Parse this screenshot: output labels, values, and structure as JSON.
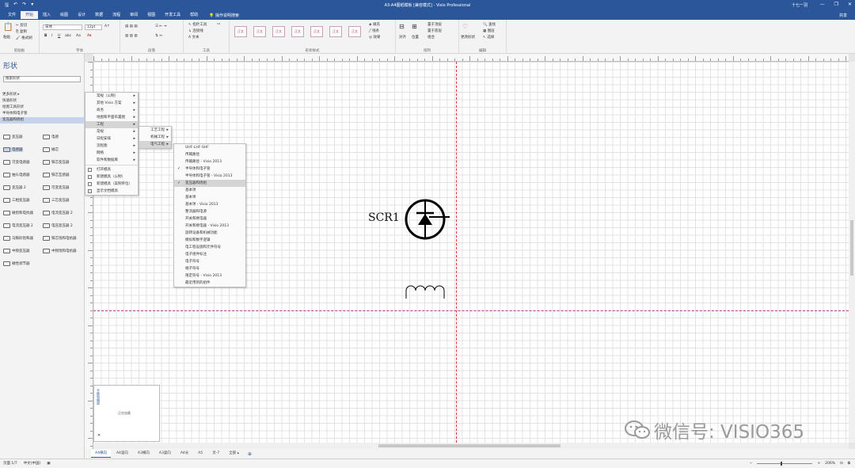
{
  "titlebar": {
    "title": "A3-A4图纸模板 [兼容模式] - Visio Professional",
    "account": "十七一羽",
    "controls": [
      "—",
      "❐",
      "✕"
    ]
  },
  "tabs": [
    "文件",
    "开始",
    "插入",
    "绘图",
    "设计",
    "数据",
    "流程",
    "审阅",
    "视图",
    "开发工具",
    "帮助"
  ],
  "tellme": "操作说明搜索",
  "share": "共享",
  "ribbon": {
    "clipboard": {
      "label": "剪贴板",
      "paste": "粘贴",
      "cut": "剪切",
      "copy": "复制",
      "format": "格式刷"
    },
    "font": {
      "label": "字体",
      "name": "宋体",
      "size": "12pt"
    },
    "paragraph": {
      "label": "段落"
    },
    "tools": {
      "label": "工具",
      "pointer": "指针工具",
      "connector": "连接线",
      "text": "A 文本"
    },
    "shape_styles": {
      "label": "形状样式",
      "sample": "正文",
      "fill": "填充",
      "line": "线条",
      "effects": "效果"
    },
    "arrange": {
      "label": "排列",
      "align": "对齐",
      "position": "位置",
      "front": "置于顶层",
      "back": "置于底层",
      "group": "组合"
    },
    "edit": {
      "label": "编辑",
      "change": "更改形状",
      "find": "查找",
      "layers": "图层",
      "select": "选择"
    }
  },
  "pane": {
    "title": "形状",
    "search_placeholder": "搜索形状",
    "stencils": [
      "更多形状 ▸",
      "快速形状",
      "绘图工具形状",
      "半导体和电子管",
      "变压器和绕组"
    ],
    "shapes": [
      [
        "变压器",
        "电感"
      ],
      [
        "电感器",
        "磁芯"
      ],
      [
        "可变电感器",
        "铁芯变压器"
      ],
      [
        "抽头电感器",
        "铁芯互感器"
      ],
      [
        "变压器 2",
        "可变变压器"
      ],
      [
        "三相变压器",
        "三芯变压器"
      ],
      [
        "磁饱和电抗器",
        "电流变压器 2"
      ],
      [
        "电流变压器 2",
        "电压变压器 2"
      ],
      [
        "马鞍形饱和器",
        "铁芯饱和电抗器"
      ],
      [
        "中频变压器",
        "中频饱和电抗器"
      ],
      [
        "磁性调节器",
        ""
      ]
    ]
  },
  "menus": {
    "m1": [
      "常规（公制）",
      "其他 Visio 方案",
      "商务",
      "地图和平面布置图",
      "工程",
      "常规",
      "日程安排",
      "流程图",
      "网络",
      "软件和数据库"
    ],
    "m1_extra": [
      "打开模具",
      "新建模具（公制）",
      "新建模具（美制单位）",
      "显示文档模具"
    ],
    "m2": [
      "工艺工程",
      "机械工程",
      "电气工程"
    ],
    "m3": [
      "UHF-LHF-SHF",
      "传输路径",
      "传输路径 - Visio 2013",
      "半导体和电子管",
      "半导体和电子管 - Visio 2013",
      "变压器和绕组",
      "基本项",
      "基本项",
      "基本项 - Visio 2013",
      "整流器和电源",
      "开关和继电器",
      "开关和继电器 - Visio 2013",
      "旋转设备和机械功能",
      "模拟和数字逻辑",
      "电工程设施和元件符号",
      "电子组件标注",
      "电子符号",
      "端子符号",
      "限定符号 - Visio 2013",
      "最近用到的组件"
    ]
  },
  "canvas": {
    "label": "SCR1"
  },
  "pan": {
    "text": "正在加载"
  },
  "page_tabs": [
    "A4横向",
    "A4竖向",
    "A3横向",
    "A3竖向",
    "A4长",
    "A5",
    "页-7",
    "全部 ▴"
  ],
  "status": {
    "page": "页面 1/7",
    "lang": "中文(中国)",
    "zoom": "206%"
  },
  "watermark": "微信号: VISIO365"
}
